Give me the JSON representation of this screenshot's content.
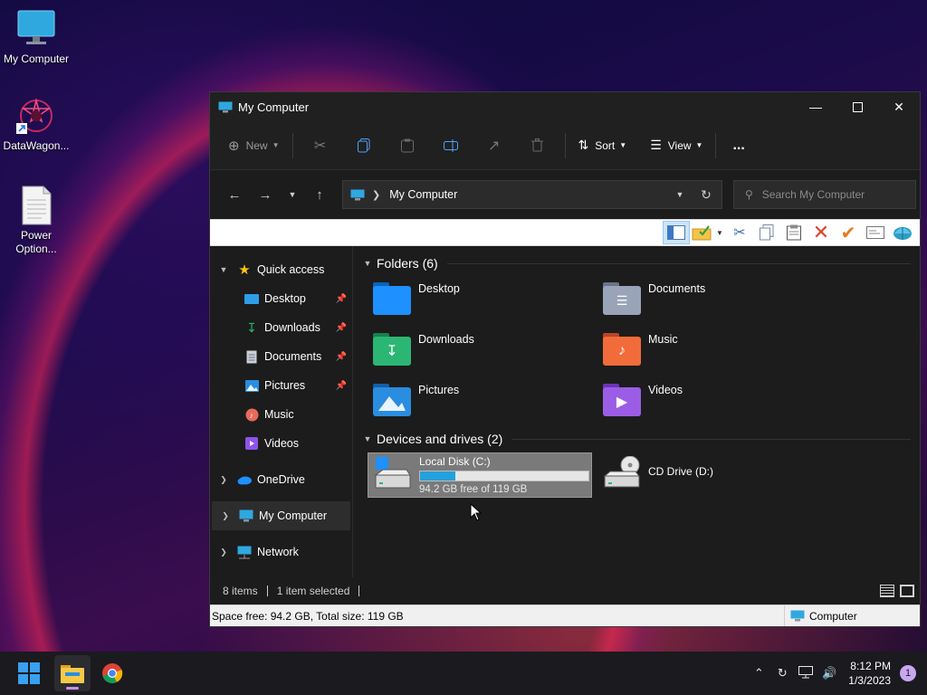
{
  "desktop": {
    "icons": [
      {
        "label": "My Computer"
      },
      {
        "label": "DataWagon..."
      },
      {
        "label": "Power Option..."
      }
    ]
  },
  "window": {
    "title": "My Computer",
    "command_bar": {
      "new_label": "New",
      "sort_label": "Sort",
      "view_label": "View",
      "more_label": "..."
    },
    "address": {
      "path": "My Computer",
      "search_placeholder": "Search My Computer"
    },
    "sidebar": {
      "quick_access": "Quick access",
      "items": [
        {
          "label": "Desktop",
          "pinned": true
        },
        {
          "label": "Downloads",
          "pinned": true
        },
        {
          "label": "Documents",
          "pinned": true
        },
        {
          "label": "Pictures",
          "pinned": true
        },
        {
          "label": "Music",
          "pinned": false
        },
        {
          "label": "Videos",
          "pinned": false
        }
      ],
      "onedrive": "OneDrive",
      "my_computer": "My Computer",
      "network": "Network"
    },
    "folders_header": "Folders (6)",
    "folders": [
      {
        "label": "Desktop",
        "color": "#1e90ff"
      },
      {
        "label": "Documents",
        "color": "#9aa4b8"
      },
      {
        "label": "Downloads",
        "color": "#2bb673"
      },
      {
        "label": "Music",
        "color": "#f26b3a"
      },
      {
        "label": "Pictures",
        "color": "#2a8de0"
      },
      {
        "label": "Videos",
        "color": "#9b5de5"
      }
    ],
    "drives_header": "Devices and drives (2)",
    "drives": [
      {
        "label": "Local Disk (C:)",
        "free_text": "94.2 GB free of 119 GB",
        "used_fraction": 0.21,
        "selected": true
      },
      {
        "label": "CD Drive (D:)"
      }
    ],
    "status": {
      "items": "8 items",
      "selected": "1 item selected"
    },
    "bottom_status": {
      "space": "Space free: 94.2 GB, Total size: 119 GB",
      "location": "Computer"
    }
  },
  "taskbar": {
    "time": "8:12 PM",
    "date": "1/3/2023",
    "notifications": "1"
  }
}
